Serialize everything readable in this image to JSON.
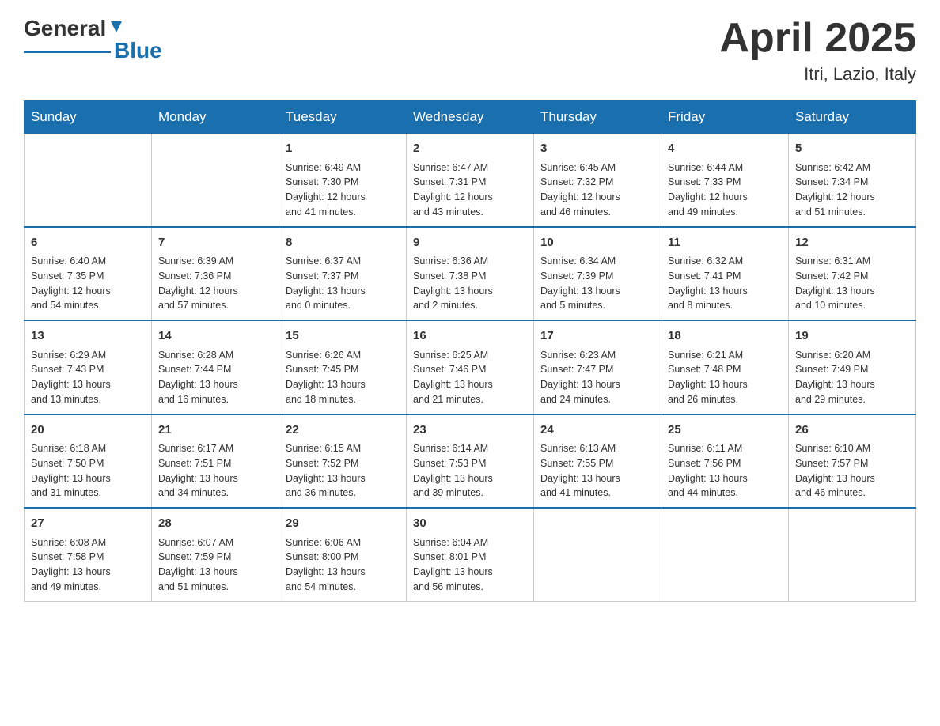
{
  "header": {
    "logo_general": "General",
    "logo_blue": "Blue",
    "month_title": "April 2025",
    "location": "Itri, Lazio, Italy"
  },
  "days_of_week": [
    "Sunday",
    "Monday",
    "Tuesday",
    "Wednesday",
    "Thursday",
    "Friday",
    "Saturday"
  ],
  "weeks": [
    [
      {
        "day": "",
        "info": ""
      },
      {
        "day": "",
        "info": ""
      },
      {
        "day": "1",
        "info": "Sunrise: 6:49 AM\nSunset: 7:30 PM\nDaylight: 12 hours\nand 41 minutes."
      },
      {
        "day": "2",
        "info": "Sunrise: 6:47 AM\nSunset: 7:31 PM\nDaylight: 12 hours\nand 43 minutes."
      },
      {
        "day": "3",
        "info": "Sunrise: 6:45 AM\nSunset: 7:32 PM\nDaylight: 12 hours\nand 46 minutes."
      },
      {
        "day": "4",
        "info": "Sunrise: 6:44 AM\nSunset: 7:33 PM\nDaylight: 12 hours\nand 49 minutes."
      },
      {
        "day": "5",
        "info": "Sunrise: 6:42 AM\nSunset: 7:34 PM\nDaylight: 12 hours\nand 51 minutes."
      }
    ],
    [
      {
        "day": "6",
        "info": "Sunrise: 6:40 AM\nSunset: 7:35 PM\nDaylight: 12 hours\nand 54 minutes."
      },
      {
        "day": "7",
        "info": "Sunrise: 6:39 AM\nSunset: 7:36 PM\nDaylight: 12 hours\nand 57 minutes."
      },
      {
        "day": "8",
        "info": "Sunrise: 6:37 AM\nSunset: 7:37 PM\nDaylight: 13 hours\nand 0 minutes."
      },
      {
        "day": "9",
        "info": "Sunrise: 6:36 AM\nSunset: 7:38 PM\nDaylight: 13 hours\nand 2 minutes."
      },
      {
        "day": "10",
        "info": "Sunrise: 6:34 AM\nSunset: 7:39 PM\nDaylight: 13 hours\nand 5 minutes."
      },
      {
        "day": "11",
        "info": "Sunrise: 6:32 AM\nSunset: 7:41 PM\nDaylight: 13 hours\nand 8 minutes."
      },
      {
        "day": "12",
        "info": "Sunrise: 6:31 AM\nSunset: 7:42 PM\nDaylight: 13 hours\nand 10 minutes."
      }
    ],
    [
      {
        "day": "13",
        "info": "Sunrise: 6:29 AM\nSunset: 7:43 PM\nDaylight: 13 hours\nand 13 minutes."
      },
      {
        "day": "14",
        "info": "Sunrise: 6:28 AM\nSunset: 7:44 PM\nDaylight: 13 hours\nand 16 minutes."
      },
      {
        "day": "15",
        "info": "Sunrise: 6:26 AM\nSunset: 7:45 PM\nDaylight: 13 hours\nand 18 minutes."
      },
      {
        "day": "16",
        "info": "Sunrise: 6:25 AM\nSunset: 7:46 PM\nDaylight: 13 hours\nand 21 minutes."
      },
      {
        "day": "17",
        "info": "Sunrise: 6:23 AM\nSunset: 7:47 PM\nDaylight: 13 hours\nand 24 minutes."
      },
      {
        "day": "18",
        "info": "Sunrise: 6:21 AM\nSunset: 7:48 PM\nDaylight: 13 hours\nand 26 minutes."
      },
      {
        "day": "19",
        "info": "Sunrise: 6:20 AM\nSunset: 7:49 PM\nDaylight: 13 hours\nand 29 minutes."
      }
    ],
    [
      {
        "day": "20",
        "info": "Sunrise: 6:18 AM\nSunset: 7:50 PM\nDaylight: 13 hours\nand 31 minutes."
      },
      {
        "day": "21",
        "info": "Sunrise: 6:17 AM\nSunset: 7:51 PM\nDaylight: 13 hours\nand 34 minutes."
      },
      {
        "day": "22",
        "info": "Sunrise: 6:15 AM\nSunset: 7:52 PM\nDaylight: 13 hours\nand 36 minutes."
      },
      {
        "day": "23",
        "info": "Sunrise: 6:14 AM\nSunset: 7:53 PM\nDaylight: 13 hours\nand 39 minutes."
      },
      {
        "day": "24",
        "info": "Sunrise: 6:13 AM\nSunset: 7:55 PM\nDaylight: 13 hours\nand 41 minutes."
      },
      {
        "day": "25",
        "info": "Sunrise: 6:11 AM\nSunset: 7:56 PM\nDaylight: 13 hours\nand 44 minutes."
      },
      {
        "day": "26",
        "info": "Sunrise: 6:10 AM\nSunset: 7:57 PM\nDaylight: 13 hours\nand 46 minutes."
      }
    ],
    [
      {
        "day": "27",
        "info": "Sunrise: 6:08 AM\nSunset: 7:58 PM\nDaylight: 13 hours\nand 49 minutes."
      },
      {
        "day": "28",
        "info": "Sunrise: 6:07 AM\nSunset: 7:59 PM\nDaylight: 13 hours\nand 51 minutes."
      },
      {
        "day": "29",
        "info": "Sunrise: 6:06 AM\nSunset: 8:00 PM\nDaylight: 13 hours\nand 54 minutes."
      },
      {
        "day": "30",
        "info": "Sunrise: 6:04 AM\nSunset: 8:01 PM\nDaylight: 13 hours\nand 56 minutes."
      },
      {
        "day": "",
        "info": ""
      },
      {
        "day": "",
        "info": ""
      },
      {
        "day": "",
        "info": ""
      }
    ]
  ]
}
